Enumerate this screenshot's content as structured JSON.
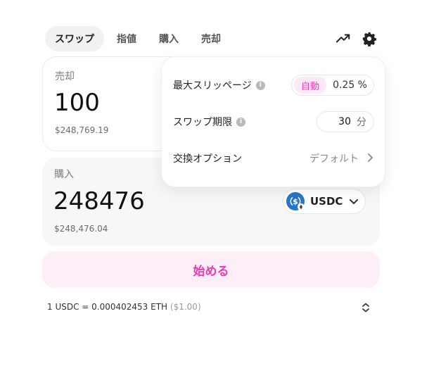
{
  "tabs": [
    {
      "label": "スワップ",
      "active": true
    },
    {
      "label": "指値",
      "active": false
    },
    {
      "label": "購入",
      "active": false
    },
    {
      "label": "売却",
      "active": false
    }
  ],
  "header": {
    "trend_icon": "trending-up-icon",
    "settings_icon": "gear-icon"
  },
  "sell": {
    "label": "売却",
    "amount": "100",
    "usd": "$248,769.19"
  },
  "buy": {
    "label": "購入",
    "amount": "248476",
    "usd": "$248,476.04",
    "token": {
      "symbol": "USDC",
      "icon": "usdc-logo-icon",
      "color": "#2775ca"
    }
  },
  "start_button": {
    "label": "始める",
    "color": "#e53fb7",
    "background": "#fdeef8"
  },
  "rate": {
    "text": "1 USDC = 0.000402453 ETH",
    "usd": "($1.00)"
  },
  "settings": {
    "slippage": {
      "label": "最大スリッページ",
      "mode": "自動",
      "value": "0.25 %"
    },
    "deadline": {
      "label": "スワップ期限",
      "value": "30",
      "unit": "分"
    },
    "exchange": {
      "label": "交換オプション",
      "value": "デフォルト"
    }
  }
}
